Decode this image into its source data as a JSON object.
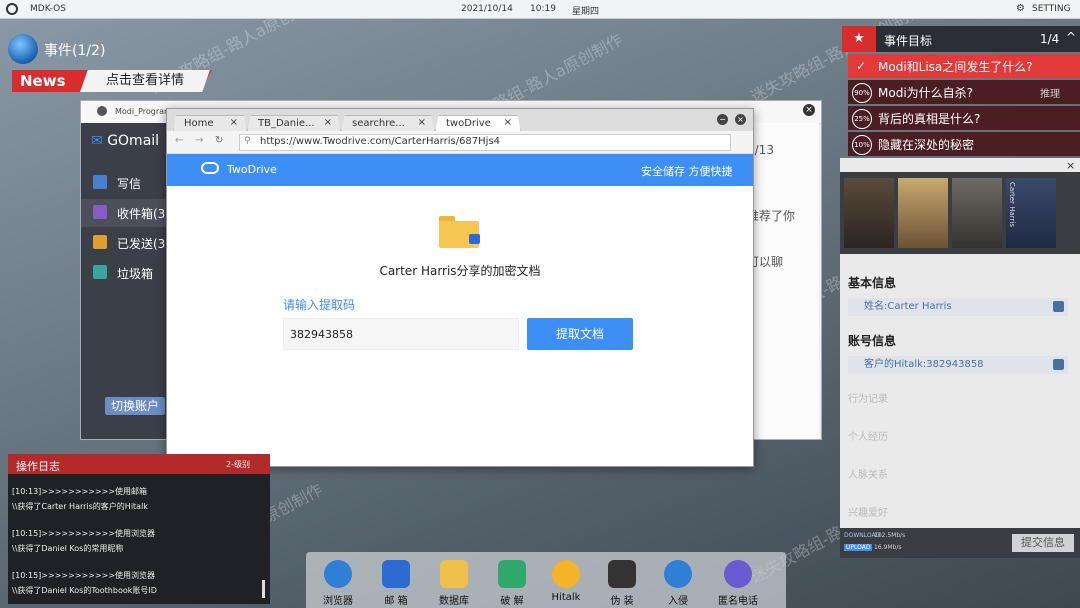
{
  "topbar": {
    "os_name": "MDK-OS",
    "date": "2021/10/14",
    "time": "10:19",
    "weekday": "星期四",
    "setting_label": "SETTING"
  },
  "news": {
    "event_title": "事件(1/2)",
    "news_label": "News",
    "news_link": "点击查看详情"
  },
  "mail": {
    "window_title": "Modi_Program",
    "brand": "GOmail",
    "items": [
      {
        "label": "写信",
        "icon": "compose-icon",
        "color": "#4a7fd0"
      },
      {
        "label": "收件箱(3)",
        "icon": "inbox-icon",
        "color": "#8a5cc6"
      },
      {
        "label": "已发送(3)",
        "icon": "send-icon",
        "color": "#e0a030"
      },
      {
        "label": "垃圾箱",
        "icon": "trash-icon",
        "color": "#3aa59a"
      }
    ],
    "switch_account": "切换账户",
    "preview_date": "7/13",
    "preview_line1": "推荐了你",
    "preview_line2": "可以聊"
  },
  "browser": {
    "tabs": [
      {
        "label": "Home",
        "active": false
      },
      {
        "label": "TB_Danie...",
        "active": false
      },
      {
        "label": "searchre...",
        "active": false
      },
      {
        "label": "twoDrive",
        "active": true
      }
    ],
    "url": "https://www.Twodrive.com/CarterHarris/687Hjs4",
    "site_name": "TwoDrive",
    "slogan": "安全储存 方便快捷",
    "doc_title": "Carter Harris分享的加密文档",
    "prompt": "请输入提取码",
    "code_value": "382943858",
    "extract_button": "提取文档"
  },
  "objectives": {
    "title": "事件目标",
    "count": "1/4",
    "items": [
      {
        "badge": "✓",
        "text": "Modi和Lisa之间发生了什么?",
        "highlight": true
      },
      {
        "badge": "90%",
        "text": "Modi为什么自杀?",
        "hint": "推理"
      },
      {
        "badge": "25%",
        "text": "背后的真相是什么?"
      },
      {
        "badge": "10%",
        "text": "隐藏在深处的秘密"
      }
    ]
  },
  "profile": {
    "photo_caption": "Carter Harris",
    "basic_title": "基本信息",
    "name_row": "姓名:Carter Harris",
    "account_title": "账号信息",
    "account_row": "客户的Hitalk:382943858",
    "faded_items": [
      "行为记录",
      "个人经历",
      "人脉关系",
      "兴趣爱好"
    ],
    "download_label": "DOWNLOAD",
    "download_speed": "102.5Mb/s",
    "upload_label": "UPLOAD",
    "upload_speed": "16.9Mb/s",
    "submit": "提交信息"
  },
  "log": {
    "title": "操作日志",
    "tag": "2-级别",
    "lines": [
      "[10:13]>>>>>>>>>>>使用邮箱",
      "\\\\获得了Carter Harris的客户的Hitalk",
      "[10:15]>>>>>>>>>>>使用浏览器",
      "\\\\获得了Daniel Kos的常用昵称",
      "[10:15]>>>>>>>>>>>使用浏览器",
      "\\\\获得了Daniel Kos的Toothbook账号ID"
    ]
  },
  "dock": [
    {
      "label": "浏览器",
      "icon": "browser-icon",
      "color": "#2f7fd6"
    },
    {
      "label": "邮 箱",
      "icon": "mail-icon",
      "color": "#2c6bd1"
    },
    {
      "label": "数据库",
      "icon": "database-icon",
      "color": "#f0c14a"
    },
    {
      "label": "破 解",
      "icon": "crack-icon",
      "color": "#2fa86a"
    },
    {
      "label": "Hitalk",
      "icon": "hitalk-icon",
      "color": "#f3b429"
    },
    {
      "label": "伪 装",
      "icon": "disguise-icon",
      "color": "#333333"
    },
    {
      "label": "入侵",
      "icon": "hook-icon",
      "color": "#2f7fd6"
    },
    {
      "label": "匿名电话",
      "icon": "phone-icon",
      "color": "#6a5ad0"
    }
  ],
  "watermark": "迷失攻略组-路人a原创制作"
}
